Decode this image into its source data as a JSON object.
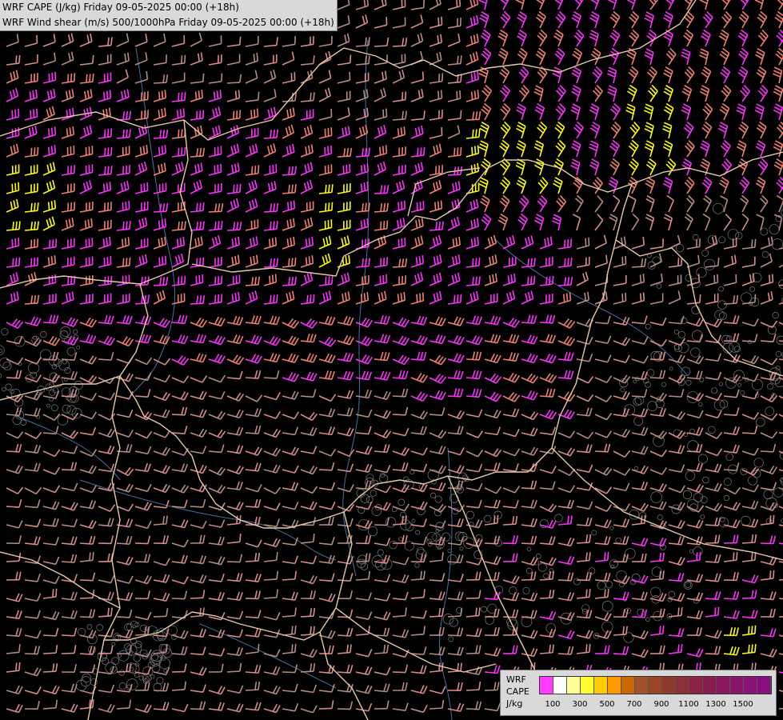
{
  "header": {
    "line1": "WRF CAPE (J/kg) Friday 09-05-2025 00:00 (+18h)",
    "line2": "WRF Wind shear (m/s) 500/1000hPa Friday 09-05-2025 00:00 (+18h)"
  },
  "legend": {
    "label_model": "WRF",
    "label_field": "CAPE",
    "label_unit": "J/kg",
    "ticks": [
      "100",
      "300",
      "500",
      "700",
      "900",
      "1100",
      "1300",
      "1500"
    ],
    "colors": [
      "#ff3cff",
      "#ffffff",
      "#ffff99",
      "#ffff33",
      "#ffcc00",
      "#ff9900",
      "#cc6600",
      "#a0522d",
      "#9b4527",
      "#8e3b2e",
      "#8b2f3a",
      "#8b2244",
      "#8b1c50",
      "#8b175c",
      "#8b1468",
      "#8b1174",
      "#8b0e80"
    ]
  },
  "colors": {
    "barb_magenta": "#ff30ff",
    "barb_salmon": "#f08070",
    "barb_rose": "#d88c8c",
    "barb_dusty": "#b88a84",
    "barb_yellow": "#ffff00",
    "border_beige": "#e8c9a8",
    "river_blue": "#4a6fa5",
    "terrain_gray": "#7a7a7a"
  }
}
